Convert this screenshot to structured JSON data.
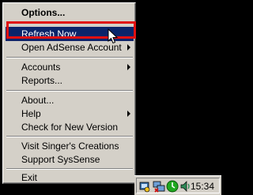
{
  "menu": {
    "items": [
      {
        "label": "Options...",
        "bold": true
      },
      {
        "label": "Refresh Now",
        "selected": true
      },
      {
        "label": "Open AdSense Account",
        "submenu": true
      },
      {
        "label": "Accounts",
        "submenu": true
      },
      {
        "label": "Reports..."
      },
      {
        "label": "About..."
      },
      {
        "label": "Help",
        "submenu": true
      },
      {
        "label": "Check for New Version"
      },
      {
        "label": "Visit Singer's Creations"
      },
      {
        "label": "Support SysSense"
      },
      {
        "label": "Exit"
      }
    ]
  },
  "tray": {
    "icons": [
      "adsense-tray-icon",
      "network-icon",
      "green-status-icon",
      "speaker-icon"
    ],
    "clock": "15:34"
  },
  "colors": {
    "menu_bg": "#d4d0c8",
    "selection": "#0a246a",
    "highlight_box": "#e01010"
  }
}
